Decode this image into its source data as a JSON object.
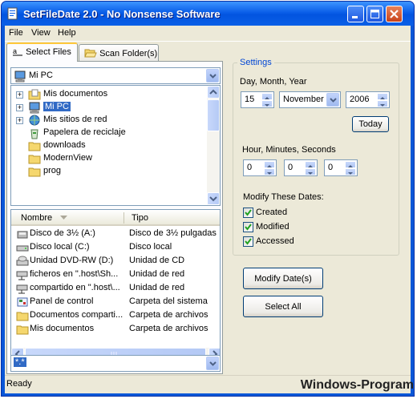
{
  "window": {
    "title": "SetFileDate 2.0 - No Nonsense Software"
  },
  "menu": [
    "File",
    "View",
    "Help"
  ],
  "tabs": [
    {
      "label": "Select Files",
      "active": true
    },
    {
      "label": "Scan Folder(s)",
      "active": false
    }
  ],
  "location_combo": {
    "value": "Mi PC"
  },
  "tree": {
    "items": [
      {
        "label": "Mis documentos",
        "icon": "folder-docs-icon",
        "expandable": true,
        "level": 1
      },
      {
        "label": "Mi PC",
        "icon": "computer-icon",
        "expandable": true,
        "selected": true,
        "level": 1
      },
      {
        "label": "Mis sitios de red",
        "icon": "network-icon",
        "expandable": true,
        "level": 1
      },
      {
        "label": "Papelera de reciclaje",
        "icon": "recycle-bin-icon",
        "expandable": false,
        "level": 1
      },
      {
        "label": "downloads",
        "icon": "folder-icon",
        "expandable": false,
        "level": 1
      },
      {
        "label": "ModernView",
        "icon": "folder-icon",
        "expandable": false,
        "level": 1
      },
      {
        "label": "prog",
        "icon": "folder-icon",
        "expandable": false,
        "level": 1
      }
    ]
  },
  "file_list": {
    "columns": [
      "Nombre",
      "Tipo"
    ],
    "rows": [
      {
        "name": "Disco de 3½ (A:)",
        "type": "Disco de 3½ pulgadas",
        "icon": "floppy-icon"
      },
      {
        "name": "Disco local (C:)",
        "type": "Disco local",
        "icon": "hard-drive-icon"
      },
      {
        "name": "Unidad DVD-RW (D:)",
        "type": "Unidad de CD",
        "icon": "dvd-drive-icon"
      },
      {
        "name": "ficheros en \".host\\Sh...",
        "type": "Unidad de red",
        "icon": "network-drive-icon"
      },
      {
        "name": "compartido en \".host\\...",
        "type": "Unidad de red",
        "icon": "network-drive-icon"
      },
      {
        "name": "Panel de control",
        "type": "Carpeta del sistema",
        "icon": "control-panel-icon"
      },
      {
        "name": "Documentos comparti...",
        "type": "Carpeta de archivos",
        "icon": "folder-icon"
      },
      {
        "name": "Mis documentos",
        "type": "Carpeta de archivos",
        "icon": "folder-icon"
      }
    ]
  },
  "filter_combo": {
    "value": "*.*"
  },
  "settings": {
    "legend": "Settings",
    "date_label": "Day, Month, Year",
    "day": "15",
    "month": "November",
    "year": "2006",
    "today_button": "Today",
    "time_label": "Hour, Minutes, Seconds",
    "hour": "0",
    "minutes": "0",
    "seconds": "0",
    "modify_label": "Modify These Dates:",
    "checks": [
      {
        "label": "Created",
        "checked": true
      },
      {
        "label": "Modified",
        "checked": true
      },
      {
        "label": "Accessed",
        "checked": true
      }
    ]
  },
  "buttons": {
    "modify": "Modify Date(s)",
    "select_all": "Select All"
  },
  "status": {
    "text": "Ready",
    "watermark": "Windows-Program"
  },
  "colors": {
    "title_bar": "#0a5ee8",
    "selection": "#316ac5",
    "settings_legend": "#0046d5"
  }
}
